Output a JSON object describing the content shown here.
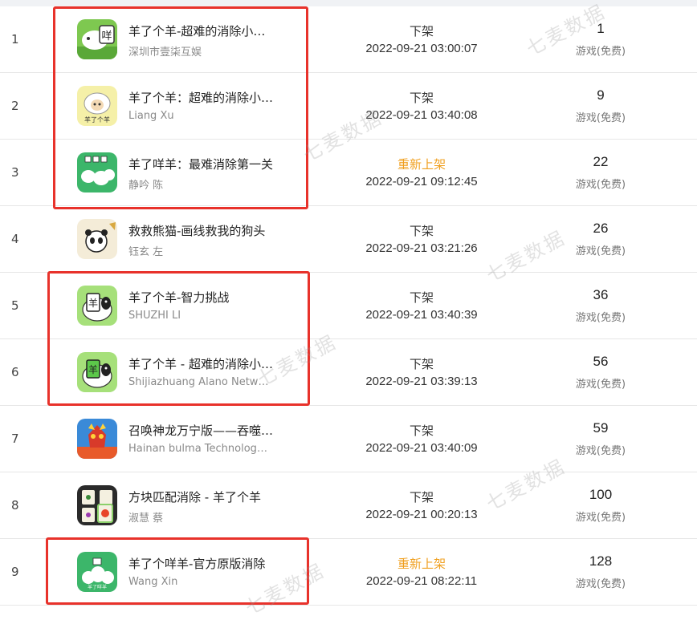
{
  "watermark": "七麦数据",
  "rows": [
    {
      "rank": "1",
      "name": "羊了个羊-超难的消除小游戏",
      "developer": "深圳市壹柒互娱",
      "status": "下架",
      "status_type": "removed",
      "time": "2022-09-21 03:00:07",
      "count": "1",
      "price": "游戏(免费)",
      "icon": "sheep-grass-icon"
    },
    {
      "rank": "2",
      "name": "羊了个羊：超难的消除小游戏",
      "developer": "Liang Xu",
      "status": "下架",
      "status_type": "removed",
      "time": "2022-09-21 03:40:08",
      "count": "9",
      "price": "游戏(免费)",
      "icon": "sheep-cartoon-icon"
    },
    {
      "rank": "3",
      "name": "羊了咩羊：最难消除第一关",
      "developer": "静吟 陈",
      "status": "重新上架",
      "status_type": "relisted",
      "time": "2022-09-21 09:12:45",
      "count": "22",
      "price": "游戏(免费)",
      "icon": "sheep-flock-icon"
    },
    {
      "rank": "4",
      "name": "救救熊猫-画线救我的狗头",
      "developer": "钰玄 左",
      "status": "下架",
      "status_type": "removed",
      "time": "2022-09-21 03:21:26",
      "count": "26",
      "price": "游戏(免费)",
      "icon": "panda-icon"
    },
    {
      "rank": "5",
      "name": "羊了个羊-智力挑战",
      "developer": "SHUZHI LI",
      "status": "下架",
      "status_type": "removed",
      "time": "2022-09-21 03:40:39",
      "count": "36",
      "price": "游戏(免费)",
      "icon": "sheep-tile-icon"
    },
    {
      "rank": "6",
      "name": "羊了个羊 - 超难的消除小游戏",
      "developer": "Shijiazhuang Alano Network Technology",
      "status": "下架",
      "status_type": "removed",
      "time": "2022-09-21 03:39:13",
      "count": "56",
      "price": "游戏(免费)",
      "icon": "sheep-tile-green-icon"
    },
    {
      "rank": "7",
      "name": "召唤神龙万宁版——吞噬进化",
      "developer": "Hainan bulma Technology Co., Ltd.",
      "status": "下架",
      "status_type": "removed",
      "time": "2022-09-21 03:40:09",
      "count": "59",
      "price": "游戏(免费)",
      "icon": "dragon-icon"
    },
    {
      "rank": "8",
      "name": "方块匹配消除 - 羊了个羊",
      "developer": "淑慧 蔡",
      "status": "下架",
      "status_type": "removed",
      "time": "2022-09-21 00:20:13",
      "count": "100",
      "price": "游戏(免费)",
      "icon": "mahjong-tile-icon"
    },
    {
      "rank": "9",
      "name": "羊了个咩羊-官方原版消除",
      "developer": "Wang Xin",
      "status": "重新上架",
      "status_type": "relisted",
      "time": "2022-09-21 08:22:11",
      "count": "128",
      "price": "游戏(免费)",
      "icon": "sheep-green-icon"
    }
  ],
  "colors": {
    "highlight": "#e8322b",
    "relisted": "#f0a020",
    "removed": "#333333"
  }
}
